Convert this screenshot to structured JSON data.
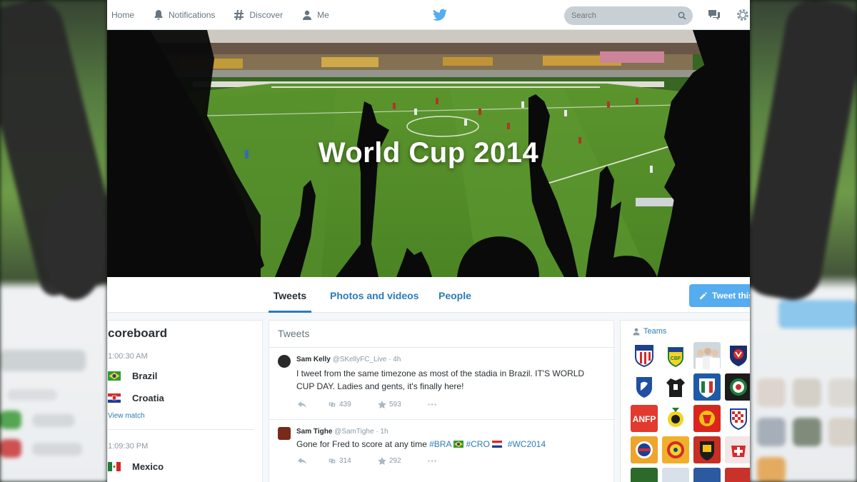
{
  "nav": {
    "home": "Home",
    "notifications": "Notifications",
    "discover": "Discover",
    "me": "Me",
    "search_placeholder": "Search"
  },
  "hero": {
    "title": "World Cup 2014"
  },
  "profile_tabs": [
    {
      "label": "Tweets",
      "active": true
    },
    {
      "label": "Photos and videos",
      "active": false
    },
    {
      "label": "People",
      "active": false
    }
  ],
  "tweet_button": "Tweet this",
  "scoreboard": {
    "title": "coreboard",
    "match1": {
      "time": "1:00:30 AM",
      "team1": "Brazil",
      "team2": "Croatia",
      "link": "View match"
    },
    "match2": {
      "time": "1:09:30 PM",
      "team1": "Mexico"
    }
  },
  "stream": {
    "header": "Tweets",
    "tweets": [
      {
        "name": "Sam Kelly",
        "handle": "@SKellyFC_Live",
        "time": "4h",
        "text": "I tweet from the same timezone as most of the stadia in Brazil. IT'S WORLD CUP DAY. Ladies and gents, it's finally here!",
        "retweets": "439",
        "favorites": "593"
      },
      {
        "name": "Sam Tighe",
        "handle": "@SamTighe",
        "time": "1h",
        "text_lead": "Gone for Fred to score at any time ",
        "tags": [
          "#BRA",
          "#CRO",
          "#WC2014"
        ],
        "retweets": "314",
        "favorites": "292"
      }
    ]
  },
  "teams": {
    "header": "Teams",
    "tiles": [
      {
        "name": "USA",
        "color": "#dbe6f2"
      },
      {
        "name": "Brazil",
        "color": "#f3efe0"
      },
      {
        "name": "England",
        "color": "#cfd8dc"
      },
      {
        "name": "Japan",
        "color": "#f2f4f6"
      },
      {
        "name": "Korea",
        "color": "#eef2f8"
      },
      {
        "name": "Brazil 2",
        "color": "#f0f0ec"
      },
      {
        "name": "Italy",
        "color": "#1f5aa6"
      },
      {
        "name": "Mexico",
        "color": "#1c1c1c"
      },
      {
        "name": "Chile",
        "color": "#e23a2e"
      },
      {
        "name": "Ghana",
        "color": "#f7f1d8"
      },
      {
        "name": "Belgium",
        "color": "#d9261c"
      },
      {
        "name": "Croatia",
        "color": "#f4f4f4"
      },
      {
        "name": "Costa Rica",
        "color": "#eda52b"
      },
      {
        "name": "Colombia",
        "color": "#f0b02a"
      },
      {
        "name": "Spain",
        "color": "#c62f24"
      },
      {
        "name": "Switzerland",
        "color": "#f3e6e6"
      }
    ]
  },
  "colors": {
    "accent": "#55acee",
    "link": "#2b7bb9",
    "text": "#292f33",
    "muted": "#8899a6"
  }
}
